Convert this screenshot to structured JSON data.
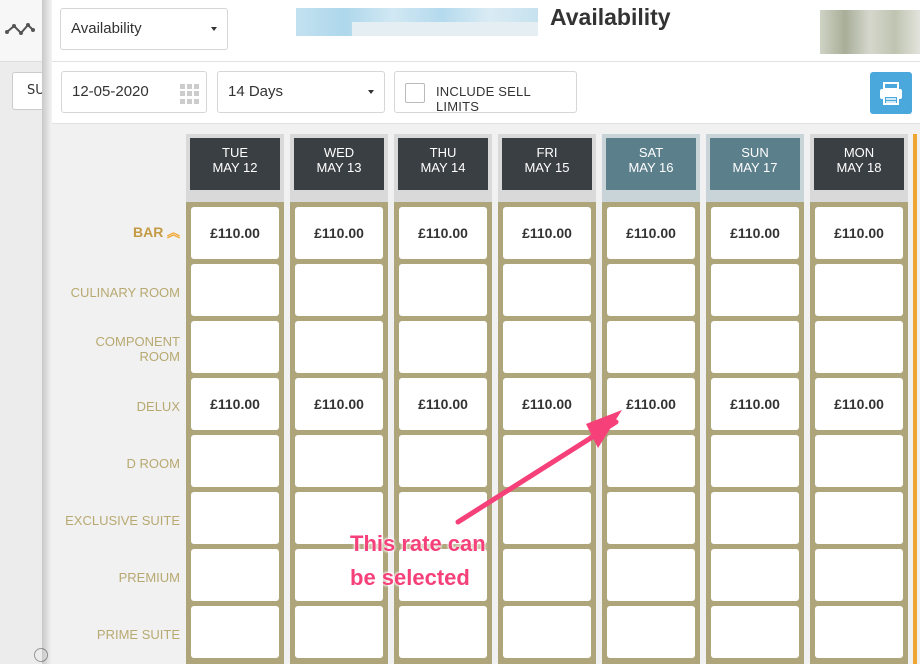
{
  "sidebar": {
    "button_label": "SU"
  },
  "header": {
    "view_select": "Availability",
    "title": "Availability"
  },
  "toolbar": {
    "date_value": "12-05-2020",
    "days_select": "14 Days",
    "sell_limits_label": "INCLUDE SELL LIMITS",
    "sell_limits_checked": false
  },
  "columns": [
    {
      "dow": "TUE",
      "date": "MAY 12",
      "weekend": false
    },
    {
      "dow": "WED",
      "date": "MAY 13",
      "weekend": false
    },
    {
      "dow": "THU",
      "date": "MAY 14",
      "weekend": false
    },
    {
      "dow": "FRI",
      "date": "MAY 15",
      "weekend": false
    },
    {
      "dow": "SAT",
      "date": "MAY 16",
      "weekend": true
    },
    {
      "dow": "SUN",
      "date": "MAY 17",
      "weekend": true
    },
    {
      "dow": "MON",
      "date": "MAY 18",
      "weekend": false
    }
  ],
  "rows": [
    {
      "label": "BAR",
      "rates": [
        "£110.00",
        "£110.00",
        "£110.00",
        "£110.00",
        "£110.00",
        "£110.00",
        "£110.00"
      ]
    },
    {
      "label": "CULINARY ROOM",
      "rates": [
        "",
        "",
        "",
        "",
        "",
        "",
        ""
      ]
    },
    {
      "label": "COMPONENT ROOM",
      "rates": [
        "",
        "",
        "",
        "",
        "",
        "",
        ""
      ]
    },
    {
      "label": "DELUX",
      "rates": [
        "£110.00",
        "£110.00",
        "£110.00",
        "£110.00",
        "£110.00",
        "£110.00",
        "£110.00"
      ]
    },
    {
      "label": "D ROOM",
      "rates": [
        "",
        "",
        "",
        "",
        "",
        "",
        ""
      ]
    },
    {
      "label": "EXCLUSIVE SUITE",
      "rates": [
        "",
        "",
        "",
        "",
        "",
        "",
        ""
      ]
    },
    {
      "label": "PREMIUM",
      "rates": [
        "",
        "",
        "",
        "",
        "",
        "",
        ""
      ]
    },
    {
      "label": "PRIME SUITE",
      "rates": [
        "",
        "",
        "",
        "",
        "",
        "",
        ""
      ]
    }
  ],
  "annotation": {
    "line1": "This rate can",
    "line2": "be selected"
  },
  "colors": {
    "accent": "#f0a531",
    "annotation": "#f5407a",
    "weekend_header": "#5b7f8b",
    "header": "#3a3f44",
    "cell_border": "#aea57a"
  }
}
